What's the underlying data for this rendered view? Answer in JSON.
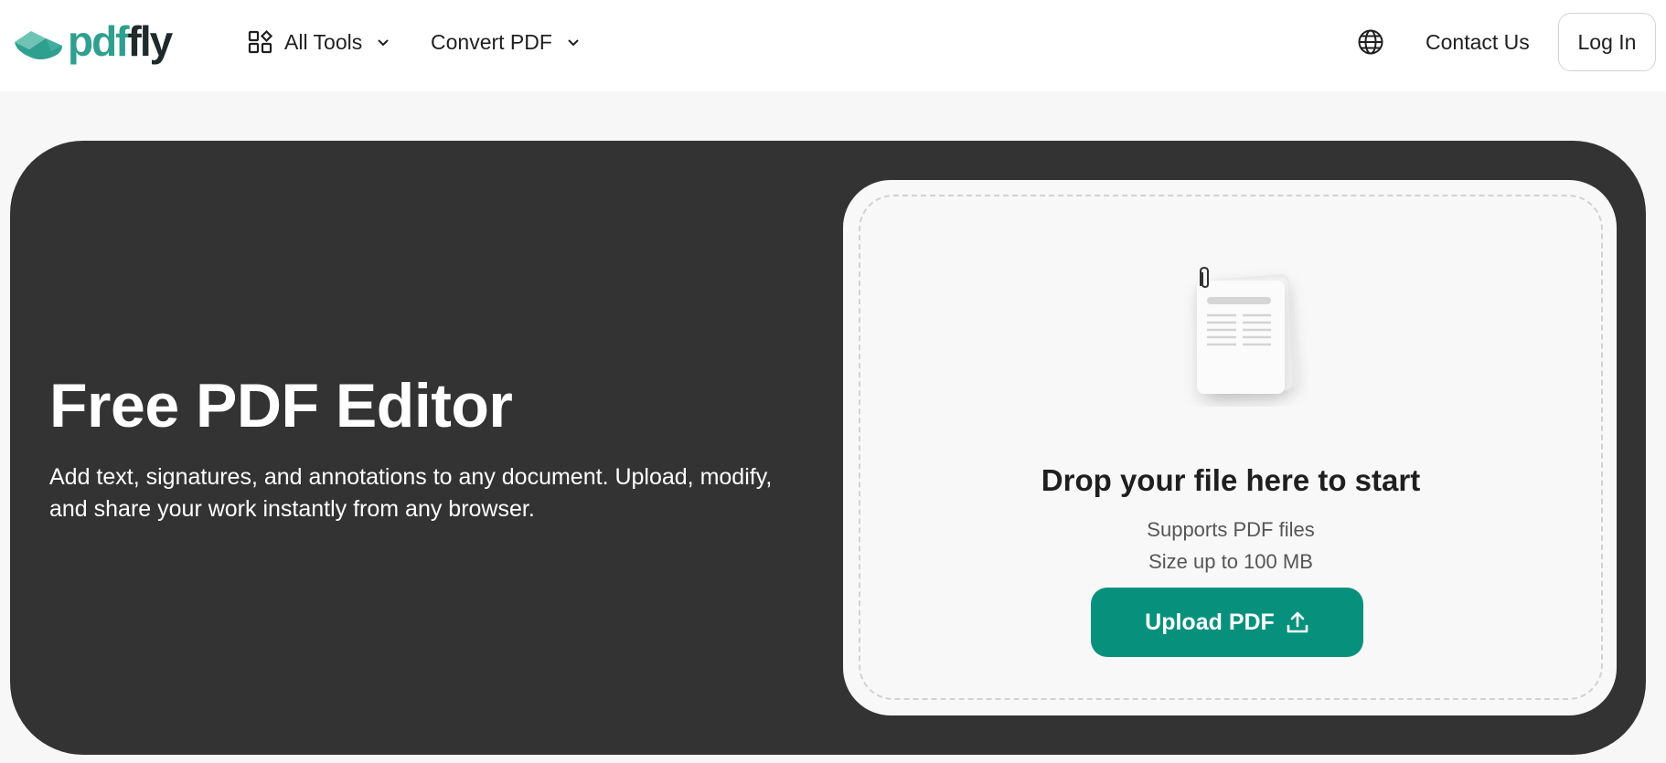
{
  "brand": {
    "logo_part1": "pdf",
    "logo_part2": "fly",
    "accent": "#2f9f8f",
    "button_color": "#07917d"
  },
  "header": {
    "all_tools_label": "All Tools",
    "convert_pdf_label": "Convert PDF",
    "contact_label": "Contact Us",
    "login_label": "Log In",
    "icons": [
      "apps-grid-icon",
      "chevron-down-icon",
      "globe-icon"
    ]
  },
  "hero": {
    "title": "Free PDF Editor",
    "description": "Add text, signatures, and annotations to any document. Upload, modify, and share your work instantly from any browser."
  },
  "upload": {
    "drop_title": "Drop your file here to start",
    "supports_text": "Supports PDF files",
    "size_text": "Size up to 100 MB",
    "button_label": "Upload PDF",
    "icons": [
      "document-stack-icon",
      "upload-icon"
    ]
  }
}
